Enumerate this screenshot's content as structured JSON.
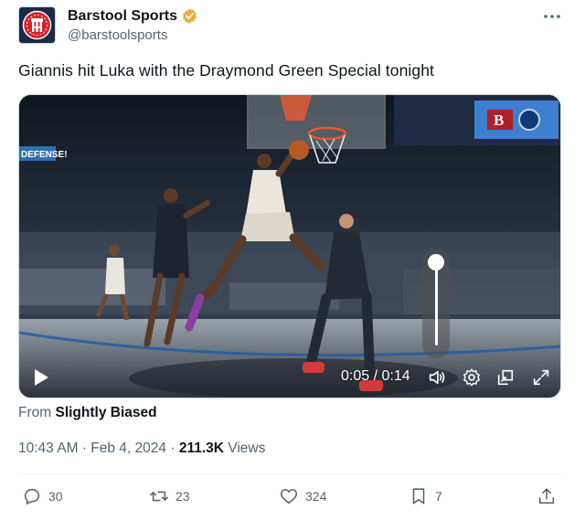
{
  "author": {
    "display_name": "Barstool Sports",
    "handle": "@barstoolsports",
    "avatar_letters": "B",
    "verified": true,
    "verified_color": "#e8b03c"
  },
  "tweet": {
    "text": "Giannis hit Luka with the Draymond Green Special tonight"
  },
  "video": {
    "current_time": "0:05",
    "separator": "/",
    "duration": "0:14",
    "volume_level": 1.0,
    "scene_text": {
      "left_banner": "DEFENSE!",
      "scoreboard_logo": "B"
    }
  },
  "source": {
    "prefix": "From",
    "name": "Slightly Biased"
  },
  "meta": {
    "time": "10:43 AM",
    "date": "Feb 4, 2024",
    "views_count": "211.3K",
    "views_label": "Views",
    "dot": "·"
  },
  "actions": {
    "replies": "30",
    "reposts": "23",
    "likes": "324",
    "bookmarks": "7"
  },
  "colors": {
    "text_primary": "#0f1419",
    "text_secondary": "#536471",
    "avatar_bg": "#1a2a47",
    "avatar_accent": "#d6222a"
  }
}
